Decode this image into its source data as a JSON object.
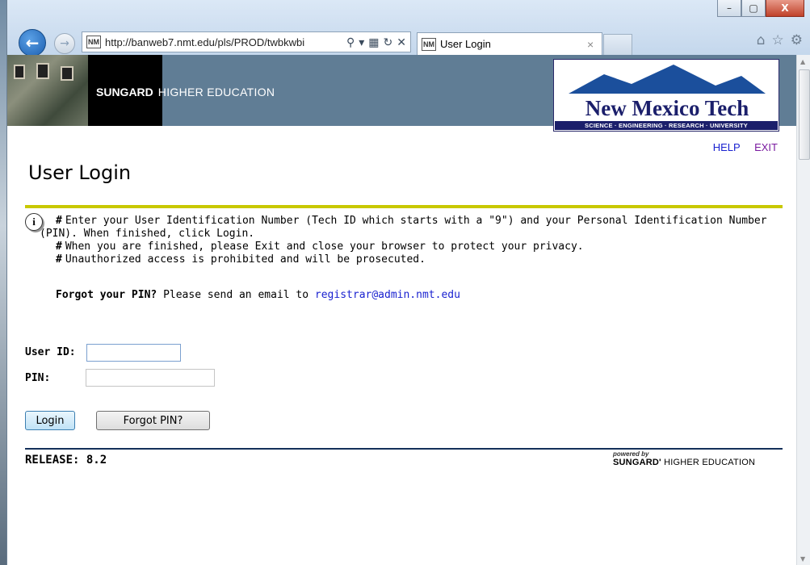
{
  "browser": {
    "url": "http://banweb7.nmt.edu/pls/PROD/twbkwbi",
    "tab_title": "User Login",
    "favicon_text": "NM",
    "window_controls": {
      "minimize": "–",
      "maximize": "▢",
      "close": "X"
    }
  },
  "banner": {
    "brand_bold": "SUNGARD",
    "brand_rest": "HIGHER EDUCATION",
    "logo_name": "New Mexico Tech",
    "logo_tagline": "SCIENCE · ENGINEERING · RESEARCH · UNIVERSITY"
  },
  "toplinks": {
    "help": "HELP",
    "exit": "EXIT"
  },
  "page": {
    "title": "User Login",
    "info_icon": "i",
    "info_lines": [
      {
        "hash": "#",
        "text": "Enter your User Identification Number (Tech ID which starts with a \"9\") and your Personal Identification Number"
      },
      {
        "hash": "",
        "text": "(PIN). When finished, click Login."
      },
      {
        "hash": "#",
        "text": "When you are finished, please Exit and close your browser to protect your privacy."
      },
      {
        "hash": "#",
        "text": "Unauthorized access is prohibited and will be prosecuted."
      }
    ],
    "forgot_bold": "Forgot your PIN?",
    "forgot_text": "Please send an email to",
    "forgot_email": "registrar@admin.nmt.edu"
  },
  "form": {
    "userid_label": "User ID:",
    "userid_value": "",
    "pin_label": "PIN:",
    "pin_value": "",
    "login_button": "Login",
    "forgot_button": "Forgot PIN?"
  },
  "footer": {
    "release": "RELEASE: 8.2",
    "powered_by": "powered by",
    "powered_brand_bold": "SUNGARD'",
    "powered_brand_rest": "HIGHER EDUCATION"
  }
}
